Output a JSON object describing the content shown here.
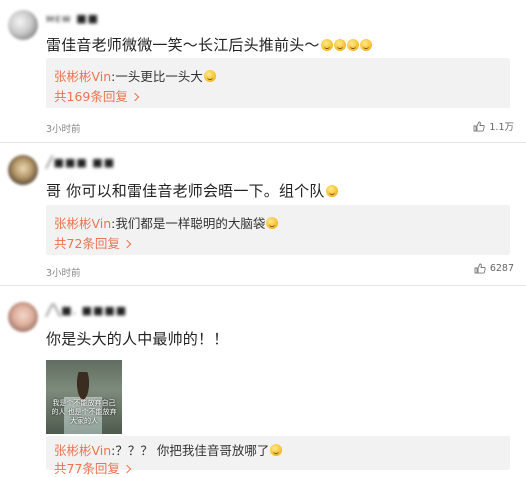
{
  "comments": [
    {
      "username": "ᴍᴇᴡ ■■",
      "content": "雷佳音老师微微一笑～长江后头推前头～",
      "reply": {
        "user": "张彬彬Vin",
        "text": ":一头更比一头大"
      },
      "reply_count": "共169条回复",
      "time": "3小时前",
      "likes": "1.1万"
    },
    {
      "username": "╱■■■ ■■",
      "content": "哥 你可以和雷佳音老师会晤一下。组个队",
      "reply": {
        "user": "张彬彬Vin",
        "text": ":我们都是一样聪明的大脑袋"
      },
      "reply_count": "共72条回复",
      "time": "3小时前",
      "likes": "6287"
    },
    {
      "username": "╱╲■. ■■■■",
      "content": "你是头大的人中最帅的！！",
      "image_caption": "我是个不能放弃自己的人 也是个不能放弃大家的人",
      "reply": {
        "user": "张彬彬Vin",
        "text": ":？？？ 你把我佳音哥放哪了"
      },
      "reply_count": "共77条回复"
    }
  ],
  "icons": {
    "like": "thumbs-up-icon",
    "chevron": "chevron-right-icon",
    "emoji": "smiley-emoji-icon"
  },
  "colors": {
    "reply_user": "#eb7350",
    "reply_box": "#f2f2f2",
    "text": "#222222",
    "meta": "#888888"
  }
}
